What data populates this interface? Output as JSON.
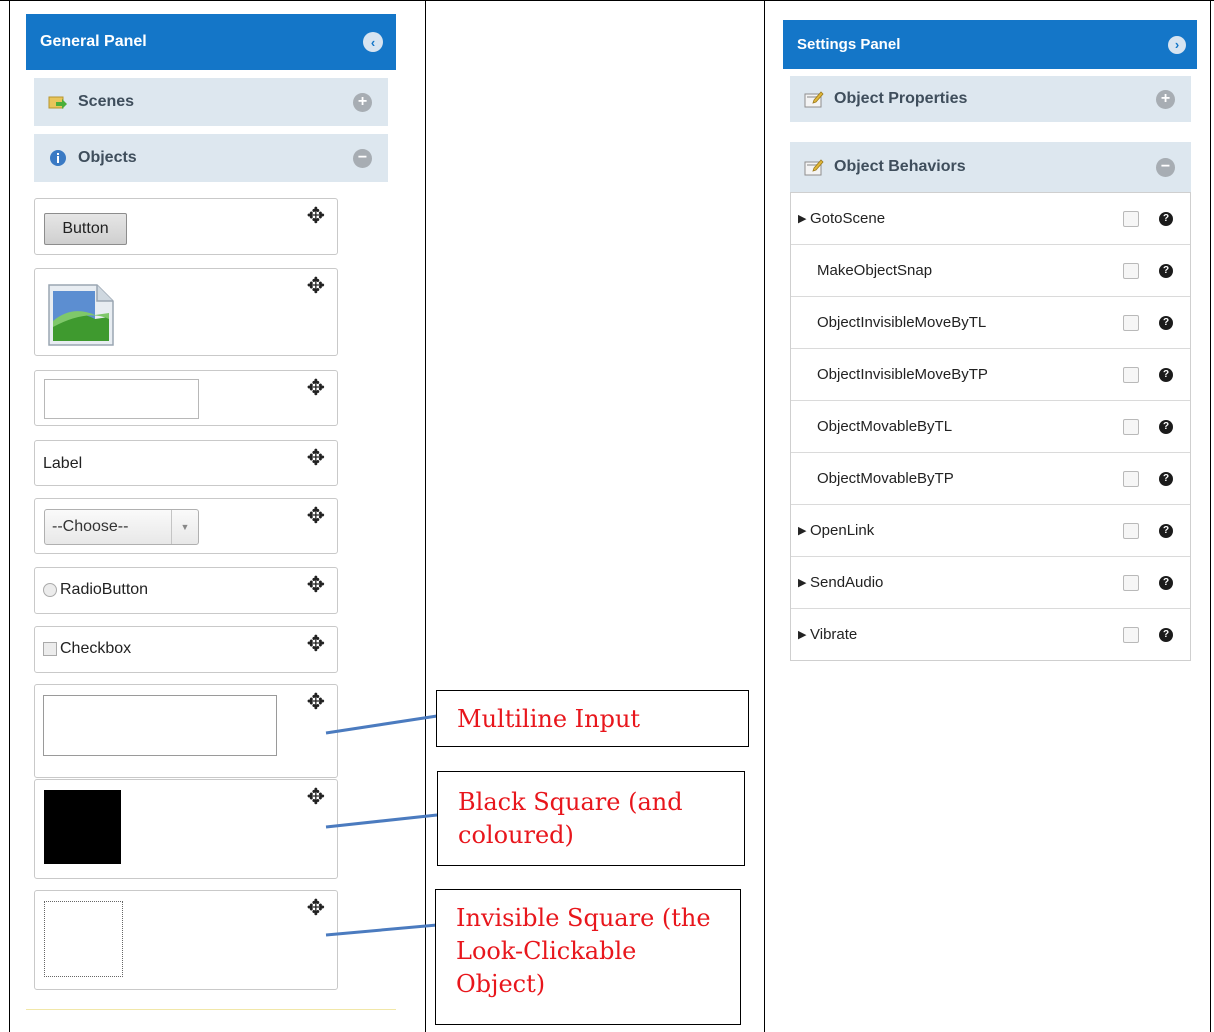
{
  "general_panel": {
    "title": "General Panel",
    "collapse_icon": "chevron-left-icon",
    "sections": {
      "scenes": {
        "label": "Scenes",
        "icon": "scenes-icon",
        "toggle": "+"
      },
      "objects": {
        "label": "Objects",
        "icon": "info-icon",
        "toggle": "−"
      }
    },
    "objects": {
      "button_label": "Button",
      "label_text": "Label",
      "select_value": "--Choose--",
      "radio_label": "RadioButton",
      "checkbox_label": "Checkbox"
    },
    "move_icon": "✥"
  },
  "settings_panel": {
    "title": "Settings Panel",
    "expand_icon": "chevron-right-icon",
    "sections": {
      "properties": {
        "label": "Object Properties",
        "toggle": "+"
      },
      "behaviors": {
        "label": "Object Behaviors",
        "toggle": "−"
      }
    },
    "behaviors": [
      {
        "name": "GotoScene",
        "expandable": true
      },
      {
        "name": "MakeObjectSnap",
        "expandable": false
      },
      {
        "name": "ObjectInvisibleMoveByTL",
        "expandable": false
      },
      {
        "name": "ObjectInvisibleMoveByTP",
        "expandable": false
      },
      {
        "name": "ObjectMovableByTL",
        "expandable": false
      },
      {
        "name": "ObjectMovableByTP",
        "expandable": false
      },
      {
        "name": "OpenLink",
        "expandable": true
      },
      {
        "name": "SendAudio",
        "expandable": true
      },
      {
        "name": "Vibrate",
        "expandable": true
      }
    ]
  },
  "callouts": {
    "multiline": "Multiline Input",
    "black_square": "Black Square (and coloured)",
    "invisible_square": "Invisible Square (the Look-Clickable Object)"
  },
  "colors": {
    "header_blue": "#1476c8",
    "section_bg": "#dde7ef",
    "callout_text": "#e8161c",
    "connector": "#4b7bbf"
  }
}
